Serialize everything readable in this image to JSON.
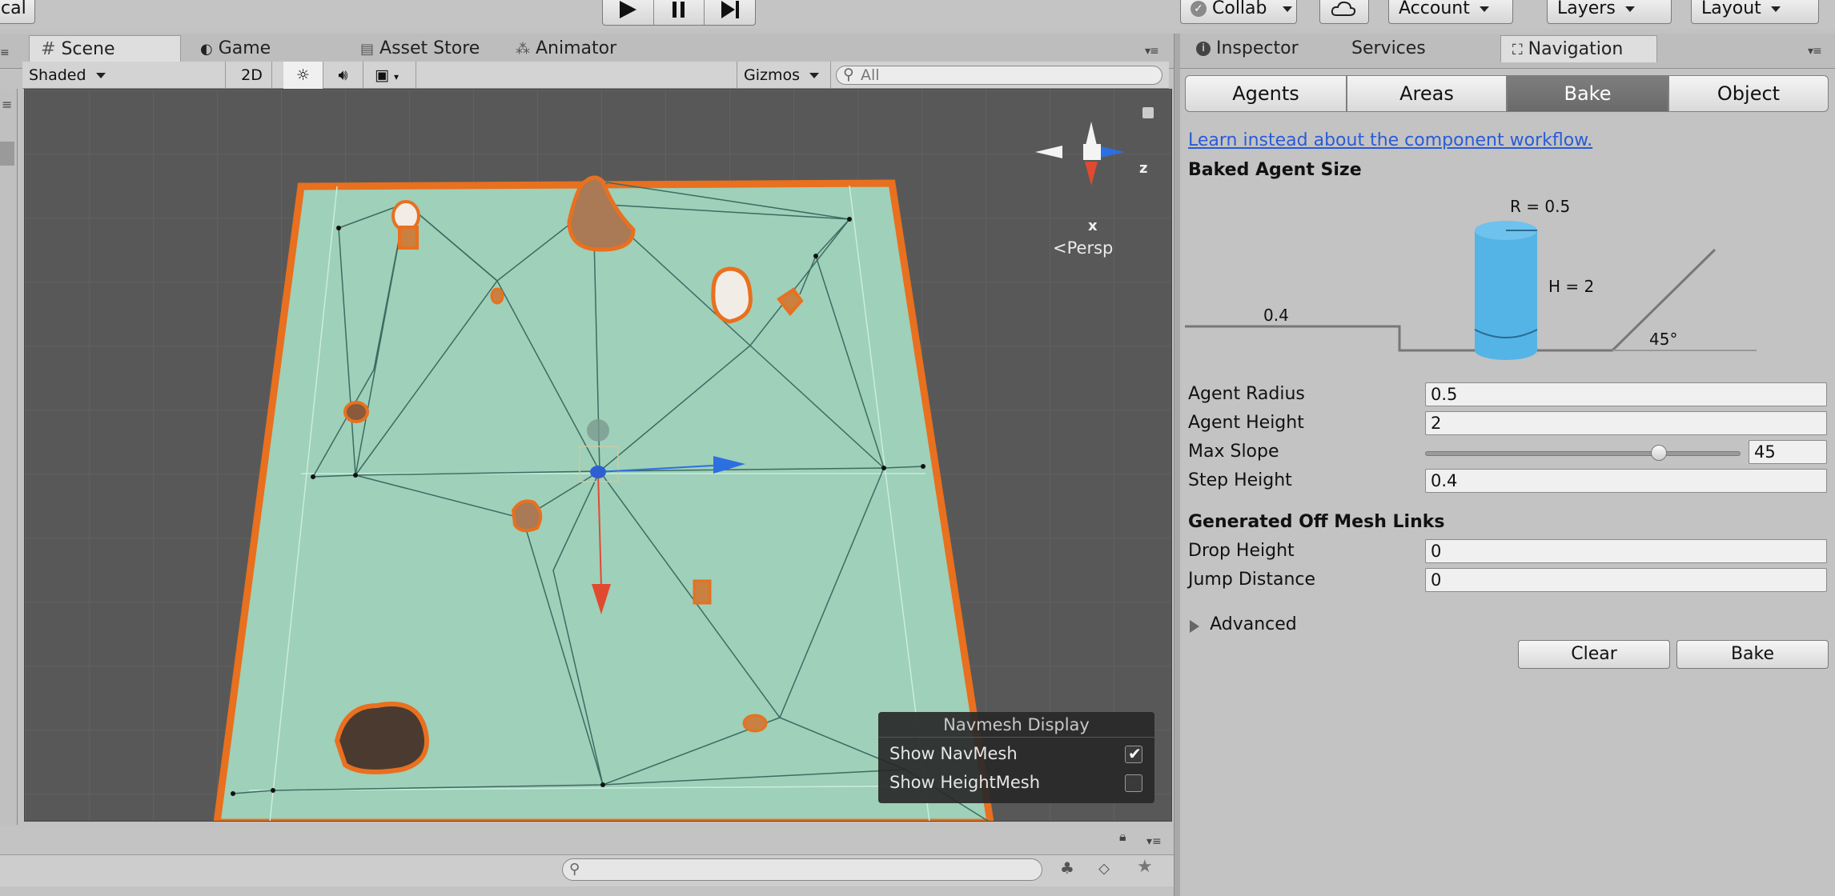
{
  "toolbar": {
    "local_label": "cal",
    "collab_label": "Collab",
    "account_label": "Account",
    "layers_label": "Layers",
    "layout_label": "Layout"
  },
  "scene_tabs": {
    "scene": "Scene",
    "game": "Game",
    "asset_store": "Asset Store",
    "animator": "Animator"
  },
  "scene_toolbar": {
    "shading_mode": "Shaded",
    "mode_2d": "2D",
    "gizmos": "Gizmos",
    "search_placeholder": "All"
  },
  "viewport": {
    "axis_z": "z",
    "axis_x": "x",
    "projection": "Persp"
  },
  "navmesh_display": {
    "title": "Navmesh Display",
    "show_navmesh": "Show NavMesh",
    "show_navmesh_checked": true,
    "show_heightmesh": "Show HeightMesh",
    "show_heightmesh_checked": false
  },
  "inspector_tabs": {
    "inspector": "Inspector",
    "services": "Services",
    "navigation": "Navigation"
  },
  "navigation": {
    "segments": [
      "Agents",
      "Areas",
      "Bake",
      "Object"
    ],
    "selected_segment": "Bake",
    "workflow_link": "Learn instead about the component workflow.",
    "baked_agent_size_title": "Baked Agent Size",
    "diagram": {
      "radius_label": "R = 0.5",
      "height_label": "H = 2",
      "step_label": "0.4",
      "slope_label": "45°"
    },
    "fields": {
      "agent_radius_label": "Agent Radius",
      "agent_radius_value": "0.5",
      "agent_height_label": "Agent Height",
      "agent_height_value": "2",
      "max_slope_label": "Max Slope",
      "max_slope_value": "45",
      "step_height_label": "Step Height",
      "step_height_value": "0.4"
    },
    "off_mesh_title": "Generated Off Mesh Links",
    "off_mesh": {
      "drop_height_label": "Drop Height",
      "drop_height_value": "0",
      "jump_distance_label": "Jump Distance",
      "jump_distance_value": "0"
    },
    "advanced_label": "Advanced",
    "clear_button": "Clear",
    "bake_button": "Bake"
  },
  "colors": {
    "navmesh_fill": "#9fd0b9",
    "outline": "#e8701f",
    "selected_segment": "#747474",
    "link": "#2a5bd7",
    "cylinder": "#55b4e6"
  }
}
